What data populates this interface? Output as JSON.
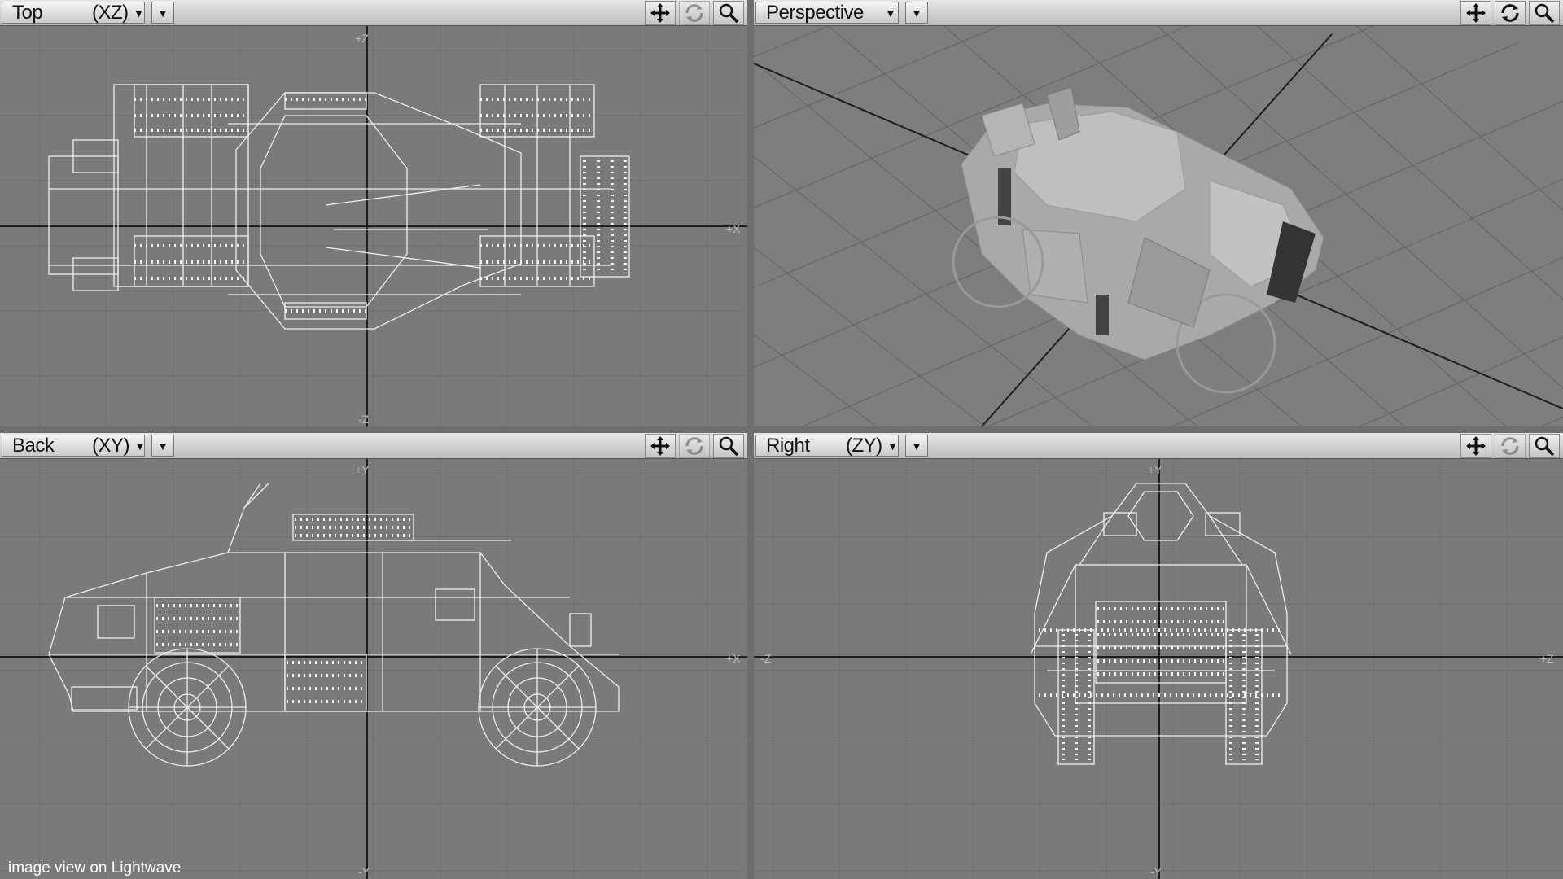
{
  "viewports": {
    "top": {
      "name": "Top",
      "axes": "(XZ)",
      "h_axis_right": "+X",
      "v_axis_top": "+Z",
      "v_axis_bottom": "-Z"
    },
    "perspective": {
      "name": "Perspective",
      "axes": ""
    },
    "back": {
      "name": "Back",
      "axes": "(XY)",
      "h_axis_right": "+X",
      "v_axis_top": "+Y",
      "v_axis_bottom": "-Y"
    },
    "right": {
      "name": "Right",
      "axes": "(ZY)",
      "h_axis_left": "-Z",
      "h_axis_right": "+Z",
      "v_axis_top": "+Y",
      "v_axis_bottom": "-Y"
    }
  },
  "tools": {
    "move_icon": "move-icon",
    "rotate_icon": "rotate-icon",
    "zoom_icon": "magnifier-icon"
  },
  "status": {
    "caption": "image view on Lightwave"
  },
  "colors": {
    "viewport_bg": "#7a7a7a",
    "grid": "#5f5f5f",
    "axis": "#1e1e1e",
    "wire": "#f2f2f2",
    "header": "#d4d4d4"
  }
}
